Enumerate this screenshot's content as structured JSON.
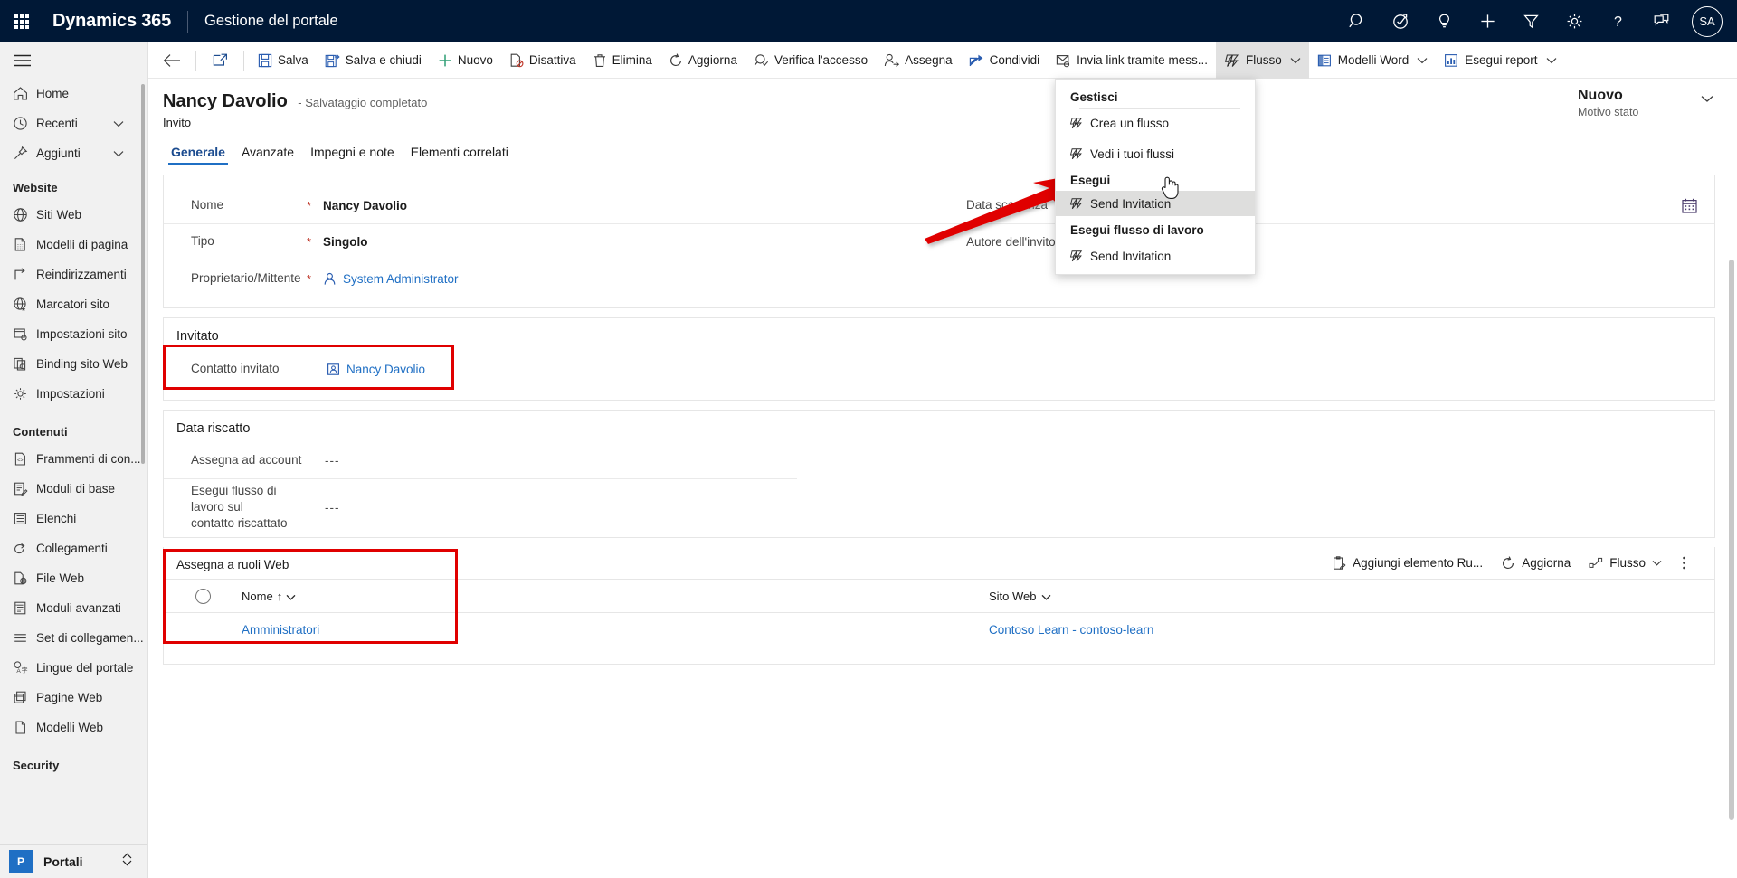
{
  "topbar": {
    "waffle_name": "app-launcher-icon",
    "brand": "Dynamics 365",
    "app_name": "Gestione del portale",
    "icons": [
      {
        "name": "search-icon",
        "label": "Ricerca"
      },
      {
        "name": "diagnostics-icon",
        "label": "Diagnostica"
      },
      {
        "name": "lightbulb-icon",
        "label": "Idee"
      },
      {
        "name": "add-icon",
        "label": "Nuovo"
      },
      {
        "name": "filter-icon",
        "label": "Filtro"
      },
      {
        "name": "gear-icon",
        "label": "Impostazioni"
      },
      {
        "name": "help-icon",
        "label": "Aiuto"
      },
      {
        "name": "feedback-icon",
        "label": "Feedback"
      }
    ],
    "avatar_initials": "SA"
  },
  "sidebar": {
    "hamburger_label": "Espandi riquadro di spostamento",
    "quick": [
      {
        "label": "Home",
        "icon": "home-icon",
        "chevron": false
      },
      {
        "label": "Recenti",
        "icon": "clock-icon",
        "chevron": true
      },
      {
        "label": "Aggiunti",
        "icon": "pin-icon",
        "chevron": true
      }
    ],
    "groups": [
      {
        "title": "Website",
        "items": [
          {
            "label": "Siti Web",
            "icon": "globe-icon"
          },
          {
            "label": "Modelli di pagina",
            "icon": "page-template-icon"
          },
          {
            "label": "Reindirizzamenti",
            "icon": "redirect-arrow-icon"
          },
          {
            "label": "Marcatori sito",
            "icon": "globe-star-icon"
          },
          {
            "label": "Impostazioni sito",
            "icon": "site-settings-icon"
          },
          {
            "label": "Binding sito Web",
            "icon": "web-binding-icon"
          },
          {
            "label": "Impostazioni",
            "icon": "gear-icon"
          }
        ]
      },
      {
        "title": "Contenuti",
        "items": [
          {
            "label": "Frammenti di con...",
            "icon": "content-snippet-icon"
          },
          {
            "label": "Moduli di base",
            "icon": "basic-form-icon"
          },
          {
            "label": "Elenchi",
            "icon": "list-icon"
          },
          {
            "label": "Collegamenti",
            "icon": "shortcut-icon"
          },
          {
            "label": "File Web",
            "icon": "web-file-icon"
          },
          {
            "label": "Moduli avanzati",
            "icon": "advanced-form-icon"
          },
          {
            "label": "Set di collegamen...",
            "icon": "link-set-icon"
          },
          {
            "label": "Lingue del portale",
            "icon": "language-icon"
          },
          {
            "label": "Pagine Web",
            "icon": "web-page-icon"
          },
          {
            "label": "Modelli Web",
            "icon": "web-template-icon"
          }
        ]
      },
      {
        "title": "Security",
        "items": []
      }
    ],
    "area_switcher": {
      "badge": "P",
      "label": "Portali",
      "icon": "area-switch-icon"
    }
  },
  "commandbar": {
    "back": {
      "name": "back-arrow-icon",
      "label": "Indietro"
    },
    "popout": {
      "name": "popout-icon",
      "label": "Apri in una nuova finestra"
    },
    "buttons": [
      {
        "label": "Salva",
        "icon": "save-icon",
        "chevron": false,
        "active": false
      },
      {
        "label": "Salva e chiudi",
        "icon": "save-close-icon",
        "chevron": false,
        "active": false
      },
      {
        "label": "Nuovo",
        "icon": "plus-icon",
        "chevron": false,
        "active": false
      },
      {
        "label": "Disattiva",
        "icon": "deactivate-icon",
        "chevron": false,
        "active": false
      },
      {
        "label": "Elimina",
        "icon": "trash-icon",
        "chevron": false,
        "active": false
      },
      {
        "label": "Aggiorna",
        "icon": "refresh-icon",
        "chevron": false,
        "active": false
      },
      {
        "label": "Verifica l'accesso",
        "icon": "check-access-icon",
        "chevron": false,
        "active": false
      },
      {
        "label": "Assegna",
        "icon": "assign-user-icon",
        "chevron": false,
        "active": false
      },
      {
        "label": "Condividi",
        "icon": "share-icon",
        "chevron": false,
        "active": false
      },
      {
        "label": "Invia link tramite mess...",
        "icon": "send-link-email-icon",
        "chevron": false,
        "active": false
      },
      {
        "label": "Flusso",
        "icon": "flow-icon",
        "chevron": true,
        "active": true
      },
      {
        "label": "Modelli Word",
        "icon": "word-template-icon",
        "chevron": true,
        "active": false
      },
      {
        "label": "Esegui report",
        "icon": "run-report-icon",
        "chevron": true,
        "active": false
      }
    ]
  },
  "flow_menu": {
    "open": true,
    "sections": [
      {
        "header": "Gestisci",
        "items": [
          {
            "label": "Crea un flusso",
            "icon": "flow-icon",
            "hover": false
          },
          {
            "label": "Vedi i tuoi flussi",
            "icon": "flow-icon",
            "hover": false
          }
        ]
      },
      {
        "header": "Esegui",
        "items": [
          {
            "label": "Send Invitation",
            "icon": "flow-icon",
            "hover": true
          }
        ]
      },
      {
        "header": "Esegui flusso di lavoro",
        "items": [
          {
            "label": "Send Invitation",
            "icon": "flow-icon",
            "hover": false
          }
        ]
      }
    ]
  },
  "record": {
    "title": "Nancy Davolio",
    "save_state": "- Salvataggio completato",
    "entity": "Invito",
    "status": {
      "value": "Nuovo",
      "label": "Motivo stato"
    }
  },
  "tabs": [
    {
      "label": "Generale",
      "selected": true
    },
    {
      "label": "Avanzate",
      "selected": false
    },
    {
      "label": "Impegni e note",
      "selected": false
    },
    {
      "label": "Elementi correlati",
      "selected": false
    }
  ],
  "general_section": {
    "left_fields": [
      {
        "label": "Nome",
        "required": "*",
        "value": "Nancy Davolio",
        "kind": "text"
      },
      {
        "label": "Tipo",
        "required": "*",
        "value": "Singolo",
        "kind": "text"
      },
      {
        "label": "Proprietario/Mittente",
        "required": "*",
        "value": "System Administrator",
        "kind": "lookup",
        "icon": "user-icon"
      }
    ],
    "right_fields": [
      {
        "label": "Data scadenza",
        "required": "+",
        "value": "---",
        "kind": "date",
        "icon": "calendar-icon"
      },
      {
        "label": "Autore dell'invito",
        "required": "",
        "value": "---",
        "kind": "text"
      }
    ]
  },
  "invitato_section": {
    "title": "Invitato",
    "fields": [
      {
        "label": "Contatto invitato",
        "value": "Nancy Davolio",
        "kind": "lookup",
        "icon": "contact-card-icon"
      }
    ]
  },
  "data_riscatto_section": {
    "title": "Data riscatto",
    "fields": [
      {
        "label": "Assegna ad account",
        "value": "---"
      },
      {
        "label": "Esegui flusso di lavoro sul contatto riscattato",
        "value": "---"
      }
    ]
  },
  "ruoli_web_section": {
    "title": "Assegna a ruoli Web",
    "toolbar": [
      {
        "label": "Aggiungi elemento Ru...",
        "icon": "add-existing-icon",
        "chevron": false
      },
      {
        "label": "Aggiorna",
        "icon": "refresh-icon",
        "chevron": false
      },
      {
        "label": "Flusso",
        "icon": "flow-small-icon",
        "chevron": true
      }
    ],
    "more_icon": "more-vertical-icon",
    "columns": [
      {
        "label": "Nome",
        "sort": "↑",
        "chevron": "⌄"
      },
      {
        "label": "Sito Web",
        "sort": "",
        "chevron": "⌄"
      }
    ],
    "rows": [
      {
        "nome": "Amministratori",
        "sito_web": "Contoso Learn - contoso-learn"
      }
    ]
  },
  "annotations": {
    "highlight_color": "#e00000",
    "arrow_color": "#e00000",
    "boxes": [
      {
        "name": "contatto-invitato-highlight"
      },
      {
        "name": "assegna-ruoli-web-highlight"
      }
    ],
    "arrow": {
      "name": "send-invitation-arrow",
      "points_to": "Send Invitation"
    },
    "cursor": {
      "name": "hand-cursor"
    }
  }
}
